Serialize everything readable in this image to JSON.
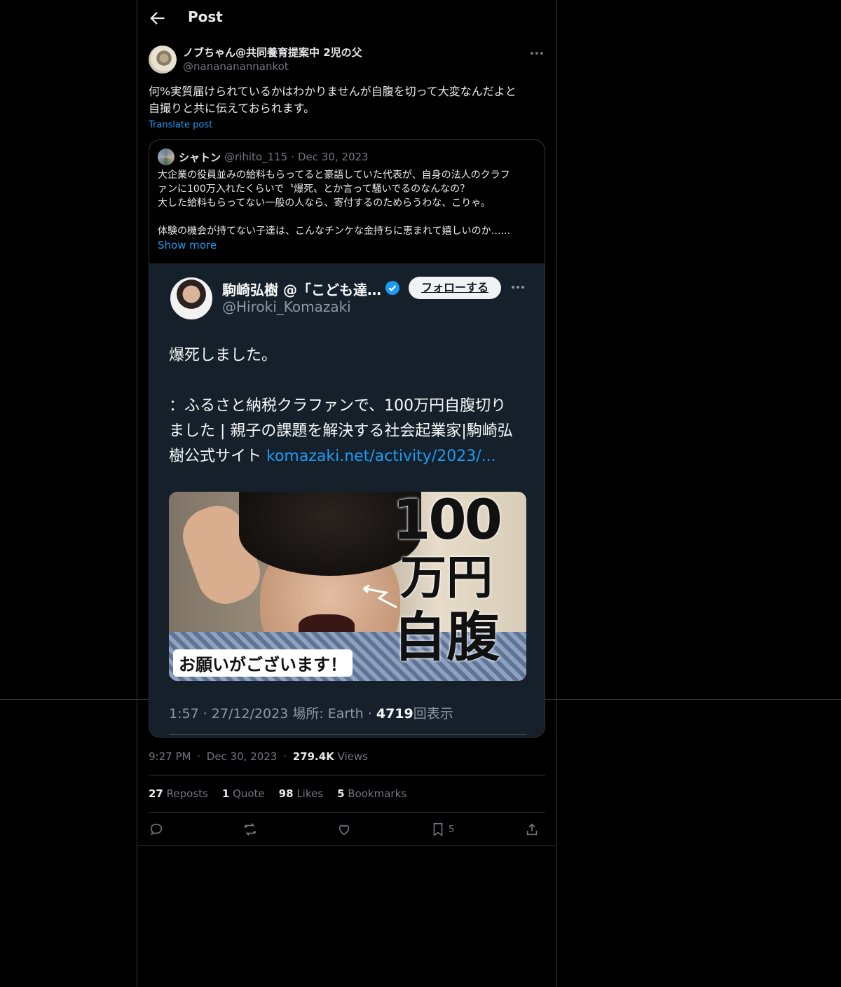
{
  "header": {
    "title": "Post"
  },
  "post": {
    "display_name": "ノブちゃん@共同養育提案中 2児の父",
    "handle": "@nanananannankot",
    "text_lines": [
      "何%実質届けられているかはわかりませんが自腹を切って大変なんだよと",
      "自撮りと共に伝えておられます。"
    ],
    "translate_label": "Translate post",
    "time": "9:27 PM",
    "date": "Dec 30, 2023",
    "views_count": "279.4K",
    "views_label": "Views",
    "stats": {
      "reposts_count": "27",
      "reposts_label": "Reposts",
      "quotes_count": "1",
      "quotes_label": "Quote",
      "likes_count": "98",
      "likes_label": "Likes",
      "bookmarks_count": "5",
      "bookmarks_label": "Bookmarks"
    },
    "actions": {
      "bookmark_count": "5"
    }
  },
  "quote": {
    "name": "シャトン",
    "handle": "@rihito_115",
    "separator": "·",
    "date": "Dec 30, 2023",
    "lines": [
      "大企業の役員並みの給料もらってると豪語していた代表が、自身の法人のクラフ",
      "ァンに100万入れたくらいで〝爆死〟とか言って騒いでるのなんなの？",
      "大した給料もらってない一般の人なら、寄付するのためらうわな、こりゃ。",
      "",
      "体験の機会が持てない子達は、こんなチンケな金持ちに恵まれて嬉しいのか…..."
    ],
    "show_more": "Show more"
  },
  "screenshot": {
    "name": "駒崎弘樹 @「こども達…",
    "follow": "フォローする",
    "handle": "@Hiroki_Komazaki",
    "text1": "爆死しました。",
    "text2a": "：ふるさと納税クラファンで、100万円自腹切り",
    "text2b": "ました | 親子の課題を解決する社会起業家|駒崎弘",
    "text2c": "樹公式サイト ",
    "link": "komazaki.net/activity/2023/...",
    "image_big1": "100",
    "image_big2": "万円",
    "image_big3": "自腹",
    "image_caption": "お願いがございます！",
    "footer_prefix": "1:57 · 27/12/2023 場所: Earth · ",
    "footer_views": "4719",
    "footer_suffix": "回表示"
  },
  "colors": {
    "accent": "#1d9bf0",
    "background": "#000000",
    "border": "#2f3336",
    "muted": "#71767b"
  },
  "icons": [
    "back-arrow-icon",
    "more-icon",
    "verified-badge-icon",
    "reply-icon",
    "repost-icon",
    "like-icon",
    "bookmark-icon",
    "share-icon"
  ]
}
